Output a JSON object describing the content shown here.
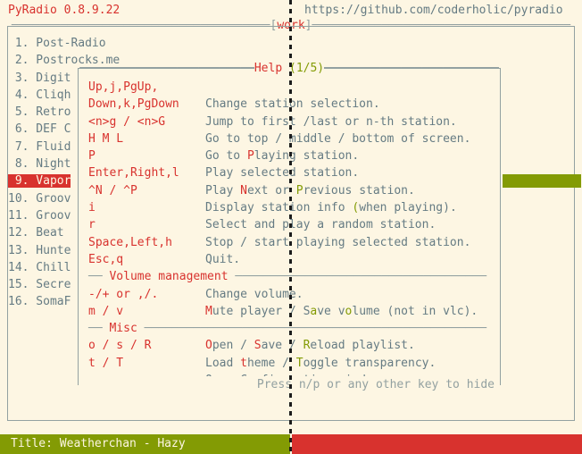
{
  "header": {
    "app_title": "PyRadio 0.8.9.22",
    "url": "https://github.com/coderholic/pyradio"
  },
  "playlist": {
    "name": "work",
    "title_prefix": "———————————————————————————————————",
    "bracket_open": "[",
    "bracket_close": "]",
    "stations": [
      {
        "num": " 1.",
        "name": "Post-Radio",
        "selected": false
      },
      {
        "num": " 2.",
        "name": "Postrocks.me",
        "selected": false
      },
      {
        "num": " 3.",
        "name": "Digit",
        "selected": false
      },
      {
        "num": " 4.",
        "name": "Cliqh",
        "selected": false
      },
      {
        "num": " 5.",
        "name": "Retro",
        "selected": false
      },
      {
        "num": " 6.",
        "name": "DEF C",
        "selected": false
      },
      {
        "num": " 7.",
        "name": "Fluid",
        "selected": false
      },
      {
        "num": " 8.",
        "name": "Night",
        "selected": false
      },
      {
        "num": " 9.",
        "name": "Vapor",
        "selected": true
      },
      {
        "num": "10.",
        "name": "Groov",
        "selected": false
      },
      {
        "num": "11.",
        "name": "Groov",
        "selected": false
      },
      {
        "num": "12.",
        "name": "Beat",
        "selected": false
      },
      {
        "num": "13.",
        "name": "Hunte",
        "selected": false
      },
      {
        "num": "14.",
        "name": "Chill",
        "selected": false
      },
      {
        "num": "15.",
        "name": "Secre",
        "selected": false
      },
      {
        "num": "16.",
        "name": "SomaF",
        "selected": false
      }
    ]
  },
  "help": {
    "title": "Help",
    "page": "(1/5)",
    "footer": "Press n/p or any other key to hide",
    "rows": [
      {
        "type": "entry",
        "keys": "Up,j,PgUp,",
        "desc": ""
      },
      {
        "type": "entry",
        "keys": "Down,k,PgDown",
        "desc": "Change station selection."
      },
      {
        "type": "entry",
        "keys": "<n>g / <n>G",
        "desc": "Jump to first /last or n-th station."
      },
      {
        "type": "entry",
        "keys": "H M L",
        "desc": "Go to top / middle / bottom of screen."
      },
      {
        "type": "entry",
        "keys": "P",
        "desc": "Go to Playing station.",
        "hl": [
          {
            "t": "P",
            "c": "red",
            "at": 6
          }
        ]
      },
      {
        "type": "entry",
        "keys": "Enter,Right,l",
        "desc": "Play selected station."
      },
      {
        "type": "entry",
        "keys": "^N / ^P",
        "desc": "Play Next or Previous station.",
        "hl": [
          {
            "t": "N",
            "c": "red",
            "at": 5
          },
          {
            "t": "P",
            "c": "olive",
            "at": 13
          }
        ]
      },
      {
        "type": "entry",
        "keys": "i",
        "desc": "Display station info (when playing).",
        "hl": [
          {
            "t": "i",
            "c": "olive",
            "at": 21
          }
        ]
      },
      {
        "type": "entry",
        "keys": "r",
        "desc": "Select and play a random station."
      },
      {
        "type": "entry",
        "keys": "Space,Left,h",
        "desc": "Stop / start playing selected station."
      },
      {
        "type": "entry",
        "keys": "Esc,q",
        "desc": "Quit."
      },
      {
        "type": "section",
        "name": "Volume management"
      },
      {
        "type": "entry",
        "keys": "-/+ or ,/.",
        "desc": "Change volume."
      },
      {
        "type": "entry",
        "keys": "m / v",
        "desc": "Mute player / Save volume (not in vlc).",
        "hl": [
          {
            "t": "M",
            "c": "red",
            "at": 0
          },
          {
            "t": "S",
            "c": "olive",
            "at": 15
          },
          {
            "t": "v",
            "c": "olive",
            "at": 20
          }
        ]
      },
      {
        "type": "section",
        "name": "Misc"
      },
      {
        "type": "entry",
        "keys": "o / s / R",
        "desc": "Open / Save / Reload playlist.",
        "hl": [
          {
            "t": "O",
            "c": "red",
            "at": 0
          },
          {
            "t": "S",
            "c": "red",
            "at": 7
          },
          {
            "t": "R",
            "c": "olive",
            "at": 14
          }
        ]
      },
      {
        "type": "entry",
        "keys": "t / T",
        "desc": "Load theme / Toggle transparency.",
        "hl": [
          {
            "t": "t",
            "c": "red",
            "at": 5
          },
          {
            "t": "T",
            "c": "olive",
            "at": 13
          }
        ]
      },
      {
        "type": "entry",
        "keys": "c",
        "desc": "Open Configuration window."
      }
    ]
  },
  "status": {
    "title_text": "Title: Weatherchan - Hazy"
  },
  "colors": {
    "background": "#fdf6e3",
    "accent_red": "#d8322e",
    "accent_olive": "#839b04",
    "text": "#657b83",
    "border": "#93a1a1"
  }
}
